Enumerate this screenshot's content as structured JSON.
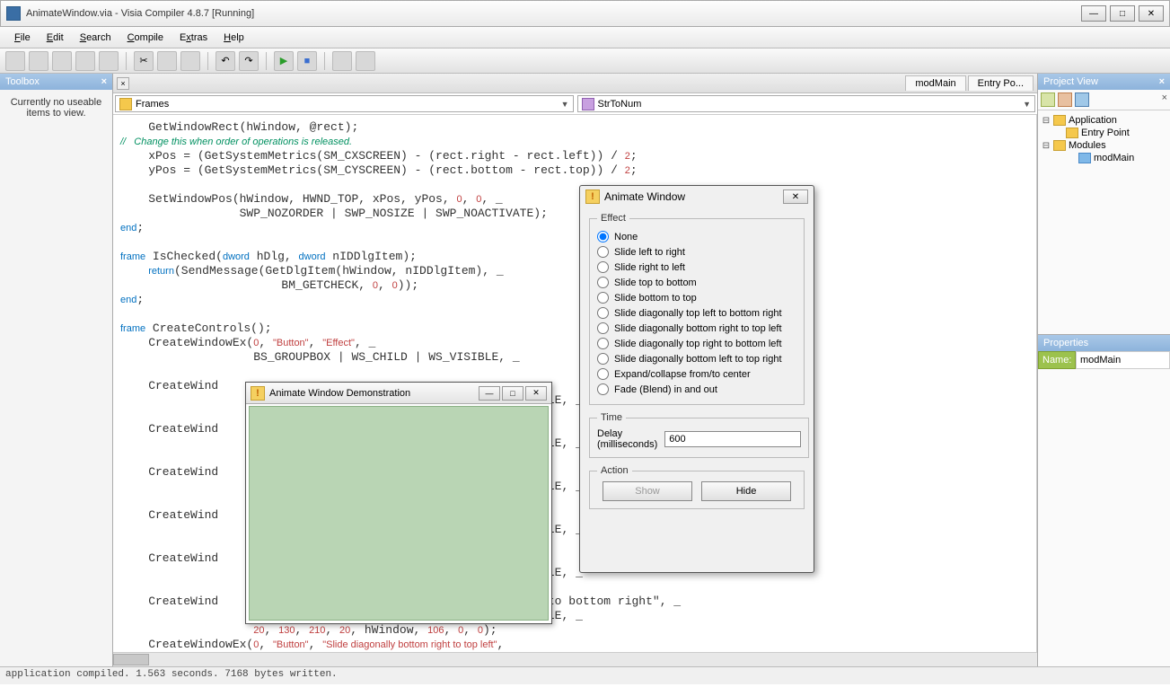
{
  "window": {
    "title": "AnimateWindow.via - Visia Compiler 4.8.7 [Running]"
  },
  "menus": [
    "File",
    "Edit",
    "Search",
    "Compile",
    "Extras",
    "Help"
  ],
  "toolbox": {
    "title": "Toolbox",
    "message": "Currently no useable items to view."
  },
  "tabs": {
    "left_close": "×",
    "right": [
      "modMain",
      "Entry Po..."
    ]
  },
  "dropdowns": {
    "left": "Frames",
    "right": "StrToNum"
  },
  "code_lines": [
    "    GetWindowRect(hWindow, @rect);",
    "//   Change this when order of operations is released.",
    "    xPos = (GetSystemMetrics(SM_CXSCREEN) - (rect.right - rect.left)) / 2;",
    "    yPos = (GetSystemMetrics(SM_CYSCREEN) - (rect.bottom - rect.top)) / 2;",
    "",
    "    SetWindowPos(hWindow, HWND_TOP, xPos, yPos, 0, 0, _",
    "                 SWP_NOZORDER | SWP_NOSIZE | SWP_NOACTIVATE);",
    "end;",
    "",
    "frame IsChecked(dword hDlg, dword nIDDlgItem);",
    "    return(SendMessage(GetDlgItem(hWindow, nIDDlgItem), _",
    "                       BM_GETCHECK, 0, 0));",
    "end;",
    "",
    "frame CreateControls();",
    "    CreateWindowEx(0, \"Button\", \"Effect\", _",
    "                   BS_GROUPBOX | WS_CHILD | WS_VISIBLE, _",
    "",
    "    CreateWind",
    "                                                           IBLE, _",
    "",
    "    CreateWind",
    "                                                           IBLE, _",
    "",
    "    CreateWind",
    "                                                           IBLE, _",
    "",
    "    CreateWind",
    "                                                           IBLE, _",
    "",
    "    CreateWind",
    "                                                           IBLE, _",
    "",
    "    CreateWind                                             t to bottom right\", _",
    "                                                           IBLE, _",
    "                   20, 130, 210, 20, hWindow, 106, 0, 0);",
    "    CreateWindowEx(0, \"Button\", \"Slide diagonally bottom right to top left\","
  ],
  "project": {
    "title": "Project View",
    "nodes": {
      "app": "Application",
      "entry": "Entry Point",
      "modules": "Modules",
      "modmain": "modMain"
    }
  },
  "properties": {
    "title": "Properties",
    "name_key": "Name:",
    "name_val": "modMain"
  },
  "status": "application compiled. 1.563 seconds. 7168 bytes written.",
  "demo": {
    "title": "Animate Window Demonstration"
  },
  "anim": {
    "title": "Animate Window",
    "effect_legend": "Effect",
    "options": [
      "None",
      "Slide left to right",
      "Slide right to left",
      "Slide top to bottom",
      "Slide bottom to top",
      "Slide diagonally top left to bottom right",
      "Slide diagonally bottom right to top left",
      "Slide diagonally top right to bottom left",
      "Slide diagonally bottom left to top right",
      "Expand/collapse from/to center",
      "Fade (Blend) in and out"
    ],
    "time_legend": "Time",
    "delay_label": "Delay (milliseconds)",
    "delay_value": "600",
    "action_legend": "Action",
    "show": "Show",
    "hide": "Hide"
  }
}
